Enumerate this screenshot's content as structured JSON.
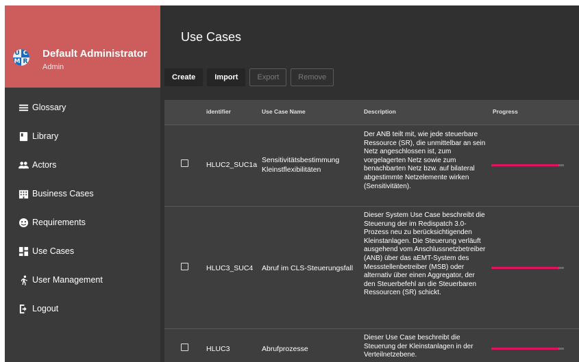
{
  "profile": {
    "name": "Default Administrator",
    "role": "Admin",
    "avatar_letters": [
      "U",
      "C",
      "M",
      "R"
    ]
  },
  "nav": [
    {
      "label": "Glossary",
      "icon": "list-icon"
    },
    {
      "label": "Library",
      "icon": "book-icon"
    },
    {
      "label": "Actors",
      "icon": "people-icon"
    },
    {
      "label": "Business Cases",
      "icon": "building-icon"
    },
    {
      "label": "Requirements",
      "icon": "face-icon"
    },
    {
      "label": "Use Cases",
      "icon": "dashboard-icon"
    },
    {
      "label": "User Management",
      "icon": "running-person-icon"
    },
    {
      "label": "Logout",
      "icon": "logout-icon"
    }
  ],
  "main": {
    "title": "Use Cases",
    "toolbar": {
      "create": "Create",
      "import": "Import",
      "export": "Export",
      "remove": "Remove"
    }
  },
  "table": {
    "headers": {
      "identifier": "identifier",
      "name": "Use Case Name",
      "description": "Description",
      "progress": "Progress"
    },
    "rows": [
      {
        "identifier": "HLUC2_SUC1a",
        "name": "Sensitivitätsbestimmung Kleinstflexibilitäten",
        "description": "Der ANB teilt mit, wie jede steuerbare Ressource (SR), die unmittelbar an sein Netz angeschlossen ist, zum vorgelagerten Netz sowie zum benachbarten Netz bzw. auf bilateral abgestimmte Netzelemente wirken (Sensitivitäten).",
        "progress": 0.92
      },
      {
        "identifier": "HLUC3_SUC4",
        "name": "Abruf im CLS-Steuerungsfall",
        "description": "Dieser System Use Case beschreibt die Steuerung der im Redispatch 3.0-Prozess neu zu berücksichtigenden Kleinstanlagen. Die Steuerung verläuft ausgehend vom Anschlussnetzbetreiber (ANB) über das aEMT-System des Messstellenbetreiber (MSB) oder alternativ über einen Aggregator, der den Steuerbefehl an die Steuerbaren Ressourcen (SR) schickt.",
        "progress": 0.92
      },
      {
        "identifier": "HLUC3",
        "name": "Abrufprozesse",
        "description": "Dieser Use Case beschreibt die Steuerung der Kleinstanlagen in der Verteilnetzebene.",
        "progress": 0.92
      }
    ]
  },
  "colors": {
    "profile_bg": "#cd5c5c",
    "sidebar_bg": "#3a3a3a",
    "main_bg": "#303030",
    "progress_fill": "#e0145c"
  }
}
